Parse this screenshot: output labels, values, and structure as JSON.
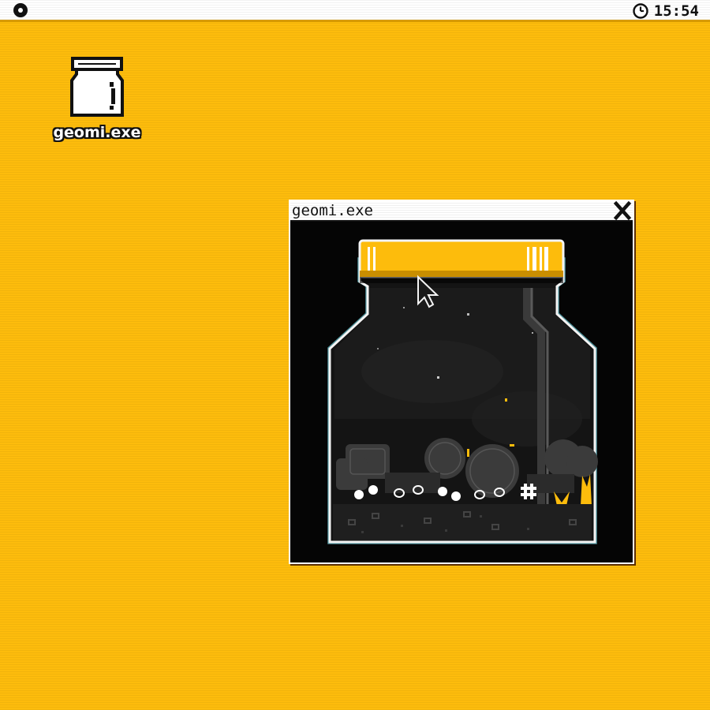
{
  "menubar": {
    "apple_icon": "circle-dot-icon",
    "clock": {
      "icon": "clock-icon",
      "time": "15:54"
    }
  },
  "desktop": {
    "icons": [
      {
        "label": "geomi.exe",
        "icon": "jar-icon"
      }
    ]
  },
  "window": {
    "title": "geomi.exe",
    "close_icon": "close-icon",
    "content": {
      "scene": "terrarium-jar",
      "cursor_icon": "arrow-cursor-icon"
    }
  },
  "colors": {
    "desktop": "#FDBC0C",
    "lid": "#FDBC0C",
    "window_bg": "#050505",
    "menubar": "#FFFFFF"
  }
}
